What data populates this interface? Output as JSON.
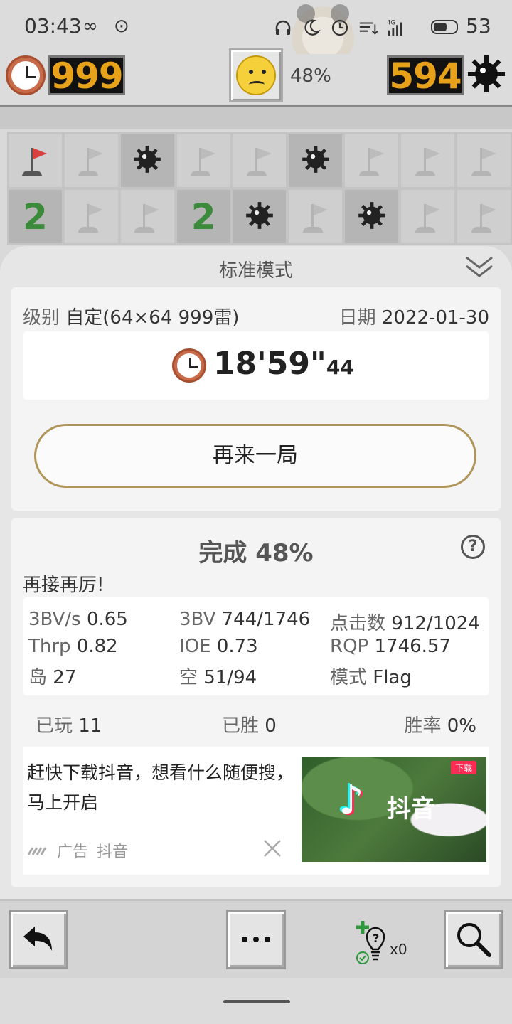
{
  "status_bar": {
    "time": "03:43",
    "battery": "53",
    "icons": [
      "infinity-icon",
      "sync-icon",
      "headphones-icon",
      "dnd-icon",
      "alarm-icon",
      "data-icon",
      "signal-icon",
      "battery-icon"
    ],
    "signal_label": "4G"
  },
  "header": {
    "timer_value": "999",
    "face": "sad-face",
    "progress": "48%",
    "mines_left": "594"
  },
  "grid": {
    "rows": [
      [
        "flag-red",
        "flag",
        "mine",
        "flag",
        "flag",
        "mine",
        "flag",
        "flag",
        "flag"
      ],
      [
        "2",
        "flag",
        "flag",
        "2",
        "mine",
        "flag",
        "mine",
        "flag",
        "flag"
      ]
    ]
  },
  "panel": {
    "title": "标准模式",
    "level_label": "级别",
    "level_value": "自定(64×64  999雷)",
    "date_label": "日期",
    "date_value": "2022-01-30",
    "time_main": "18'59\"",
    "time_ms": "44",
    "replay_label": "再来一局",
    "done_label": "完成",
    "done_value": "48%",
    "help": "?",
    "cheer": "再接再厉!",
    "stats": [
      {
        "label": "3BV/s",
        "value": "0.65"
      },
      {
        "label": "3BV",
        "value": "744/1746"
      },
      {
        "label": "点击数",
        "value": "912/1024"
      },
      {
        "label": "Thrp",
        "value": "0.82"
      },
      {
        "label": "IOE",
        "value": "0.73"
      },
      {
        "label": "RQP",
        "value": "1746.57"
      },
      {
        "label": "岛",
        "value": "27"
      },
      {
        "label": "空",
        "value": "51/94"
      },
      {
        "label": "模式",
        "value": "Flag"
      }
    ],
    "played_label": "已玩",
    "played_value": "11",
    "won_label": "已胜",
    "won_value": "0",
    "rate_label": "胜率",
    "rate_value": "0%"
  },
  "ad": {
    "text": "赶快下载抖音，想看什么随便搜，马上开启",
    "tag": "广告",
    "source": "抖音",
    "image_brand": "抖音",
    "image_badge": "下载"
  },
  "toolbar": {
    "hint_count": "x0"
  },
  "colors": {
    "lcd_text": "#e8a21a",
    "number_green": "#3c8a3c",
    "replay_border": "#b0965a",
    "flag_red": "#d94040"
  }
}
